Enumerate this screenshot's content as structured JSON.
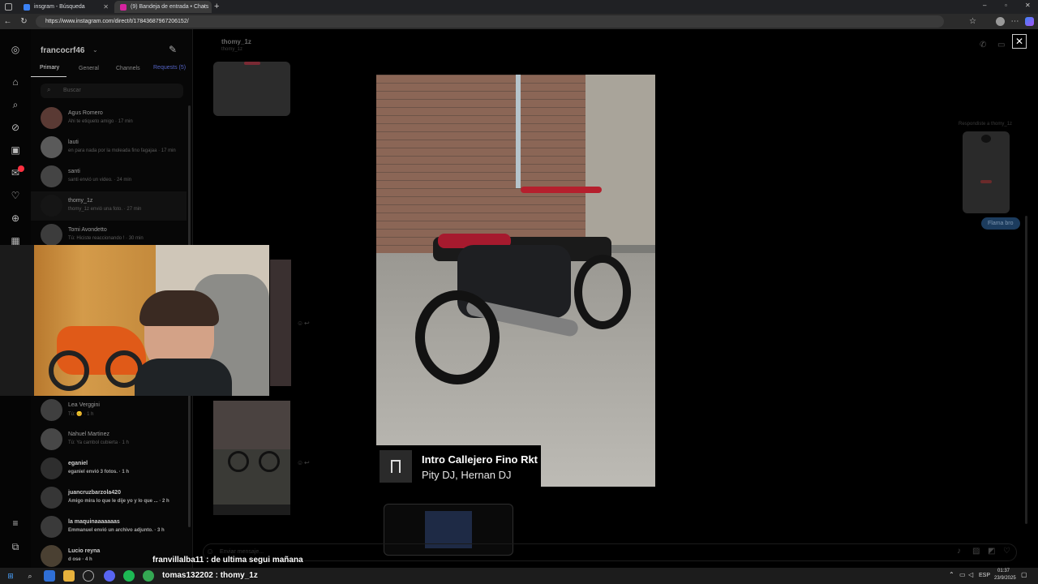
{
  "browser": {
    "tabs": [
      {
        "label": "insgram - Búsqueda",
        "active": false
      },
      {
        "label": "(9) Bandeja de entrada • Chats",
        "active": true
      }
    ],
    "new_tab": "+",
    "url": "https://www.instagram.com/direct/t/17843687967206152/",
    "window_controls": [
      "–",
      "▫",
      "✕"
    ]
  },
  "inbox": {
    "username": "francocrf46",
    "tabs": [
      "Primary",
      "General",
      "Channels",
      "Requests (5)"
    ],
    "search_placeholder": "Buscar",
    "threads": [
      {
        "name": "Agus Romero",
        "preview": "Ahi te etiqueto amigo · 17 min"
      },
      {
        "name": "lauti",
        "preview": "en para nada por la moleada fino fagajaa · 17 min"
      },
      {
        "name": "santi",
        "preview": "santi envió un video. · 24 min"
      },
      {
        "name": "thomy_1z",
        "preview": "thomy_1z envió una foto. · 27 min"
      },
      {
        "name": "Tomi Avondetto",
        "preview": "Tú: Hiciste reaccionando ! · 30 min"
      },
      {
        "name": "Lea Verggini",
        "preview": "Tú: 😊 · 1 h"
      },
      {
        "name": "Nahuel Martinez",
        "preview": "Tú: Ya cambol cubierta · 1 h"
      },
      {
        "name": "eganiel",
        "preview": "eganiel envió 3 fotos. · 1 h"
      },
      {
        "name": "juancruzbarzola420",
        "preview": "Amigo mira lo que le dije yo y lo que ... · 2 h"
      },
      {
        "name": "la maquinaaaaaaas",
        "preview": "Emmanuel envió un archivo adjunto. · 3 h"
      },
      {
        "name": "Lucio reyna",
        "preview": "d ose · 4 h"
      }
    ]
  },
  "chat": {
    "contact_name": "thomy_1z",
    "contact_handle": "thomy_1z",
    "reply_label": "Respondiste a thomy_1z",
    "bubble": "Flama bro",
    "message_placeholder": "Enviar mensaje..."
  },
  "viewer": {
    "close": "✕",
    "song_title": "Intro Callejero Fino Rkt",
    "song_artists": "Pity DJ, Hernan DJ"
  },
  "stream_chat": [
    {
      "user": "franvillalba11",
      "text": " : de ultima segui mañana"
    },
    {
      "user": "tomas132202",
      "text": " : thomy_1z"
    }
  ],
  "taskbar": {
    "lang": "ESP",
    "time": "01:37",
    "date": "23/9/2025"
  },
  "colors": {
    "accent": "#4a5df9",
    "bubble": "#3797f0",
    "badge": "#ff3040"
  }
}
